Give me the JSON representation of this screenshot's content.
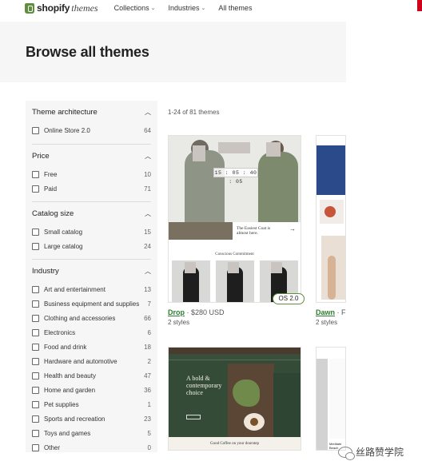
{
  "nav": {
    "logo_text": "shopify",
    "logo_sub": "themes",
    "links": [
      {
        "label": "Collections"
      },
      {
        "label": "Industries"
      },
      {
        "label": "All themes"
      }
    ]
  },
  "hero": {
    "title": "Browse all themes"
  },
  "sidebar": {
    "groups": [
      {
        "title": "Theme architecture",
        "options": [
          {
            "label": "Online Store 2.0",
            "count": "64"
          }
        ]
      },
      {
        "title": "Price",
        "options": [
          {
            "label": "Free",
            "count": "10"
          },
          {
            "label": "Paid",
            "count": "71"
          }
        ]
      },
      {
        "title": "Catalog size",
        "options": [
          {
            "label": "Small catalog",
            "count": "15"
          },
          {
            "label": "Large catalog",
            "count": "24"
          }
        ]
      },
      {
        "title": "Industry",
        "options": [
          {
            "label": "Art and entertainment",
            "count": "13"
          },
          {
            "label": "Business equipment and supplies",
            "count": "7"
          },
          {
            "label": "Clothing and accessories",
            "count": "66"
          },
          {
            "label": "Electronics",
            "count": "6"
          },
          {
            "label": "Food and drink",
            "count": "18"
          },
          {
            "label": "Hardware and automotive",
            "count": "2"
          },
          {
            "label": "Health and beauty",
            "count": "47"
          },
          {
            "label": "Home and garden",
            "count": "36"
          },
          {
            "label": "Pet supplies",
            "count": "1"
          },
          {
            "label": "Sports and recreation",
            "count": "23"
          },
          {
            "label": "Toys and games",
            "count": "5"
          },
          {
            "label": "Other",
            "count": "0"
          }
        ]
      }
    ]
  },
  "results": {
    "count_text": "1-24 of 81 themes"
  },
  "cards": [
    {
      "name": "Drop",
      "price": " · $280 USD",
      "styles": "2 styles",
      "badge": "OS 2.0",
      "thumb_timer": "15 : 05 : 40 : 05",
      "thumb_headline": "The Easiest Coat is almost here.",
      "thumb_section": "Conscious Commitment"
    },
    {
      "name": "Dawn",
      "price": " · Fr",
      "styles": "2 styles"
    },
    {
      "thumb_headline": "A bold & contemporary choice",
      "thumb_footer": "Good Coffee on your doorstep"
    },
    {
      "thumb_caption": "Meditate Beach"
    }
  ],
  "watermark": {
    "text": "丝路赞学院"
  }
}
